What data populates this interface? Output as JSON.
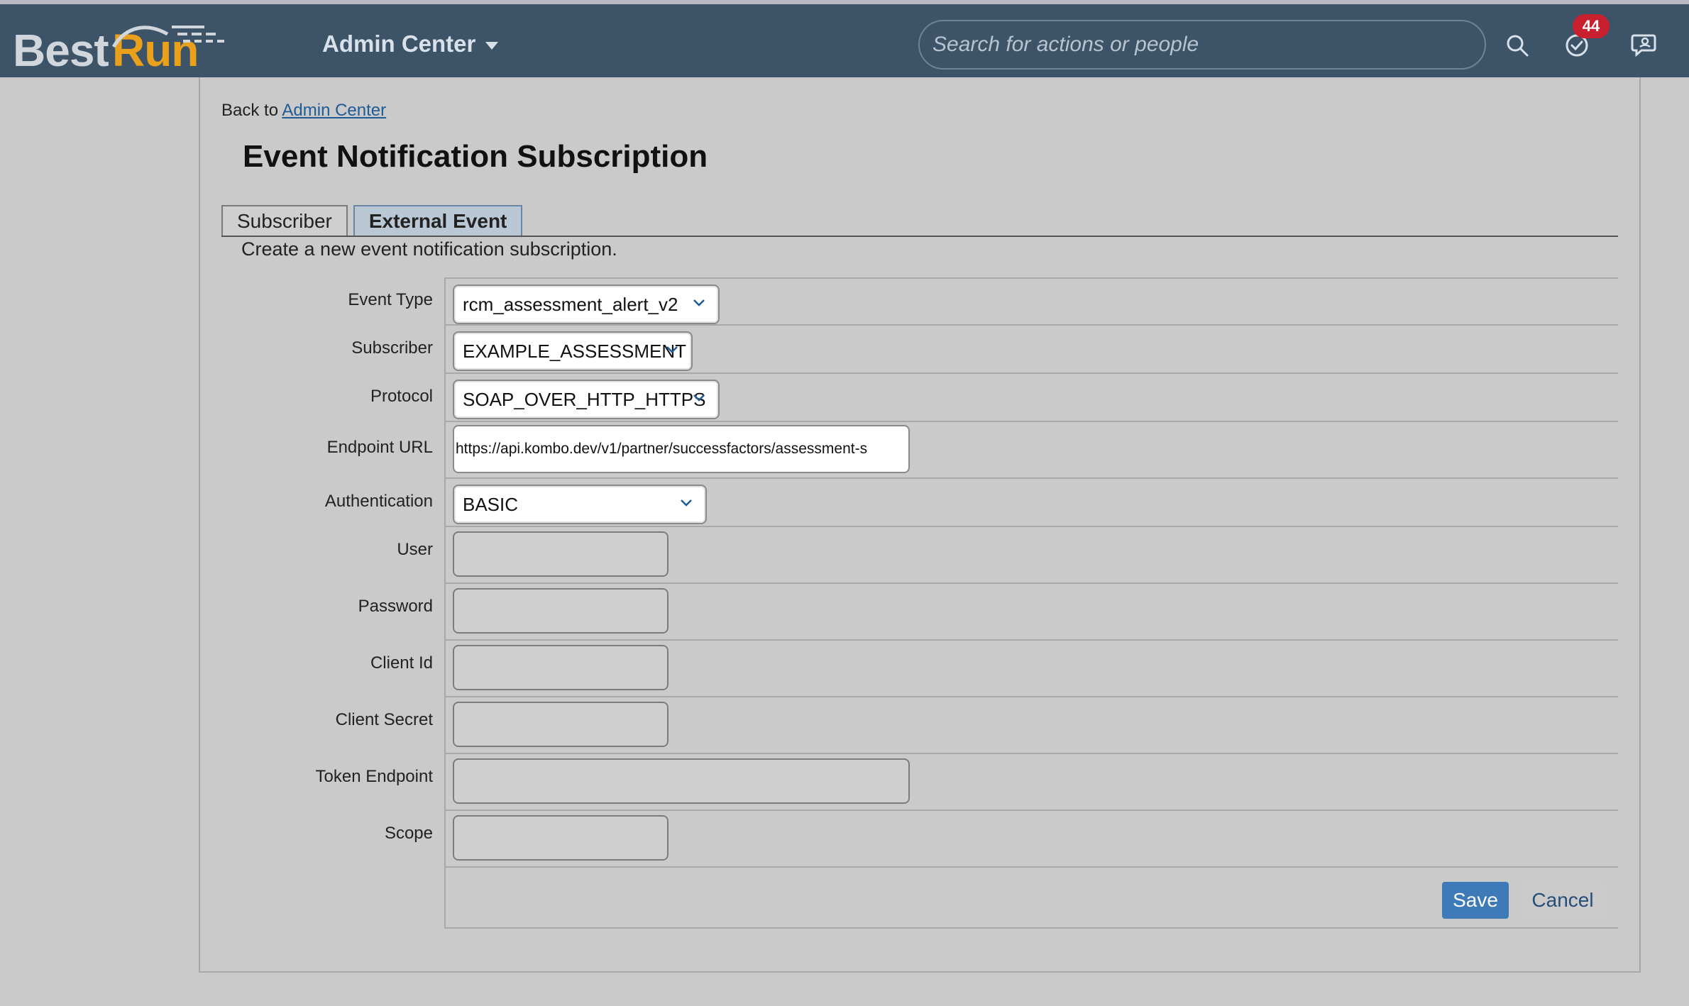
{
  "shell": {
    "logo_best": "Best",
    "logo_run": "Run",
    "admin_menu_label": "Admin Center",
    "search_placeholder": "Search for actions or people",
    "notification_count": "44"
  },
  "breadcrumb": {
    "prefix": "Back to",
    "link": "Admin Center"
  },
  "page": {
    "title": "Event Notification Subscription",
    "subtitle": "Create a new event notification subscription."
  },
  "tabs": [
    {
      "label": "Subscriber",
      "active": false
    },
    {
      "label": "External Event",
      "active": true
    }
  ],
  "form": {
    "event_type": {
      "label": "Event Type",
      "value": "rcm_assessment_alert_v2"
    },
    "subscriber": {
      "label": "Subscriber",
      "value": "EXAMPLE_ASSESSMENT"
    },
    "protocol": {
      "label": "Protocol",
      "value": "SOAP_OVER_HTTP_HTTPS"
    },
    "endpoint_url": {
      "label": "Endpoint URL",
      "value": "https://api.kombo.dev/v1/partner/successfactors/assessment-s"
    },
    "authentication": {
      "label": "Authentication",
      "value": "BASIC"
    },
    "user": {
      "label": "User",
      "value": ""
    },
    "password": {
      "label": "Password",
      "value": ""
    },
    "client_id": {
      "label": "Client Id",
      "value": ""
    },
    "client_secret": {
      "label": "Client Secret",
      "value": ""
    },
    "token_endpoint": {
      "label": "Token Endpoint",
      "value": ""
    },
    "scope": {
      "label": "Scope",
      "value": ""
    }
  },
  "actions": {
    "save_label": "Save",
    "cancel_label": "Cancel"
  },
  "colors": {
    "shellbar": "#3d5468",
    "logo_accent": "#e9a01a",
    "badge": "#c9202f",
    "primary_button": "#3d7ab7",
    "background": "#cacaca"
  }
}
